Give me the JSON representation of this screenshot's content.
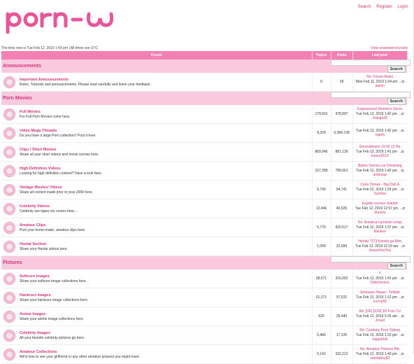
{
  "header": {
    "logo_text": "porn-ω",
    "links": [
      "Search",
      "Register",
      "Login"
    ],
    "time_text": "The time now is Tue Feb 12, 2019 1:43 pm | All times are UTC",
    "view_unanswered": "View unanswered posts"
  },
  "table_header": {
    "forum": "Forum",
    "topics": "Topics",
    "posts": "Posts",
    "last_post": "Last post"
  },
  "search_button": "Search",
  "goto_icon": "→◘",
  "categories": [
    {
      "name": "Announcements",
      "forums": [
        {
          "title": "Important Announcements",
          "desc": "Rules, Tutorials and announcements. Please read carefully and leave your feedback.",
          "topics": "6",
          "posts": "39",
          "last_title": "Re: Forum Rules",
          "last_date": "Mon Feb 11, 2019 1:04 pm",
          "last_user": "admin"
        }
      ]
    },
    {
      "name": "Porn Movies",
      "forums": [
        {
          "title": "Full Movies",
          "desc": "For Full Porn Movies come here.",
          "topics": "179,601",
          "posts": "478,897",
          "last_title": "Experienced Women's Secre",
          "last_date": "Tue Feb 12, 2019 1:42 pm",
          "last_user": "Xaluge28"
        },
        {
          "title": "Video Mega Threads",
          "desc": "Do you have a large Porn collection? Post it here.",
          "topics": "8,329",
          "posts": "6,384,738",
          "last_title": "",
          "last_date": "Tue Feb 12, 2019 1:42 pm",
          "last_user": "nujefo"
        },
        {
          "title": "Clips / Short Movies",
          "desc": "Share all your short videos and movie scenes here.",
          "topics": "869,045",
          "posts": "881,139",
          "last_title": "Eternaldesire 19 02 12 Ha",
          "last_date": "Tue Feb 12, 2019 1:41 pm",
          "last_user": "trance2512"
        },
        {
          "title": "High Definition Videos",
          "desc": "Looking for high definition content? Have a look here.",
          "topics": "157,358",
          "posts": "789,661",
          "last_title": "Babes Darcia Lee Dreaming",
          "last_date": "Tue Feb 12, 2019 1:42 pm",
          "last_user": "anttnoap"
        },
        {
          "title": "Vintage Movies/ Videos",
          "desc": "Share all content made prior to year 2000 here.",
          "topics": "5,740",
          "posts": "94,741",
          "last_title": "Color Climax - Big Dick A",
          "last_date": "Tue Feb 12, 2019 1:24 pm",
          "last_user": "Xuniline"
        },
        {
          "title": "Celebrity Videos",
          "desc": "Celebrity sex tapes etc comes here...",
          "topics": "12,446",
          "posts": "40,926",
          "last_title": "Explicit scenes celebrit",
          "last_date": "Tue Feb 12, 2019 12:57 pm",
          "last_user": "Xlasmo"
        },
        {
          "title": "Amateur Clips",
          "desc": "Post your home-made, amateur clips here",
          "topics": "5,776",
          "posts": "920,517",
          "last_title": "Re: Amateur cumshot compi",
          "last_date": "Tue Feb 12, 2019 1:37 pm",
          "last_user": "blackee"
        },
        {
          "title": "Hentai Section",
          "desc": "Share your Hentai videos here.",
          "topics": "1,058",
          "posts": "32,684",
          "last_title": "Hentai 7373 Kanojo ga Mim",
          "last_date": "Tue Feb 12, 2019 11:19 am",
          "last_user": "JessieKissYou"
        }
      ]
    },
    {
      "name": "Pictures",
      "forums": [
        {
          "title": "Softcore Images",
          "desc": "Share your softcore image collections here.",
          "topics": "38,571",
          "posts": "316,062",
          "last_title": "Y",
          "last_date": "Tue Feb 12, 2019 1:41 pm",
          "last_user": "OldeVersion"
        },
        {
          "title": "Hardcore Images",
          "desc": "Share your hardcore image collections here.",
          "topics": "61,371",
          "posts": "97,532",
          "last_title": "Jenessee Haase - Telltale",
          "last_date": "Tue Feb 12, 2019 1:12 pm",
          "last_user": "Lenny85"
        },
        {
          "title": "Anime Images",
          "desc": "Share your anime image collections here.",
          "topics": "620",
          "posts": "30,440",
          "last_title": "Re: [DF] [X29] 3D Porn Co",
          "last_date": "Tue Feb 12, 2019 5:35 am",
          "last_user": "Jonad"
        },
        {
          "title": "Celebrity Images",
          "desc": "All your favorite celebrity pictures go here.",
          "topics": "5,480",
          "posts": "17,225",
          "last_title": "Re: Celebrity Porn Videop",
          "last_date": "Tue Feb 12, 2019 1:23 pm",
          "last_user": "happy8all"
        },
        {
          "title": "Amateur Collections",
          "desc": "We'd love to see your girlfriend or any other amateur pictures you might have.",
          "topics": "5,142",
          "posts": "332,212",
          "last_title": "Re: Amateur Pictures Mix",
          "last_date": "Tue Feb 12, 2019 1:40 pm",
          "last_user": "vanillaboy83"
        }
      ]
    }
  ]
}
